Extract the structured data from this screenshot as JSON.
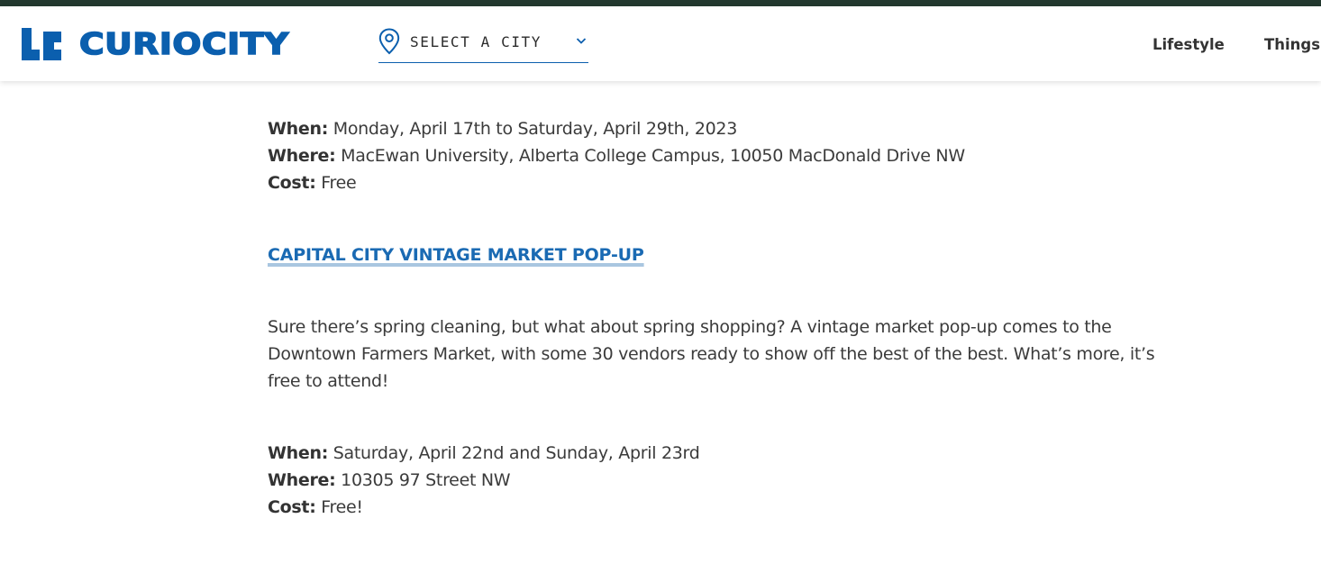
{
  "header": {
    "logo_text": "CURIOCITY",
    "city_select": {
      "label": "SELECT A CITY",
      "icon": "location-pin-icon",
      "chevron": "chevron-down-icon"
    },
    "nav": [
      {
        "label": "Lifestyle"
      },
      {
        "label": "Things T"
      }
    ]
  },
  "event1": {
    "when_label": "When:",
    "when_value": " Monday, April 17th to Saturday, April 29th, 2023",
    "where_label": "Where:",
    "where_value": " MacEwan University, Alberta College Campus, 10050 MacDonald Drive NW",
    "cost_label": "Cost:",
    "cost_value": " Free"
  },
  "event2": {
    "title": "CAPITAL CITY VINTAGE MARKET POP-UP",
    "description": "Sure there’s spring cleaning, but what about spring shopping? A vintage market pop-up comes to the Downtown Farmers Market, with some 30 vendors ready to show off the best of the best. What’s more, it’s free to attend!",
    "when_label": "When:",
    "when_value": " Saturday, April 22nd and Sunday, April 23rd",
    "where_label": "Where:",
    "where_value": " 10305 97 Street NW",
    "cost_label": "Cost:",
    "cost_value": " Free!"
  },
  "colors": {
    "brand_blue": "#0b5fae",
    "link_blue": "#1a6ab3",
    "top_strip": "#23392f",
    "text": "#3b3b3b"
  }
}
